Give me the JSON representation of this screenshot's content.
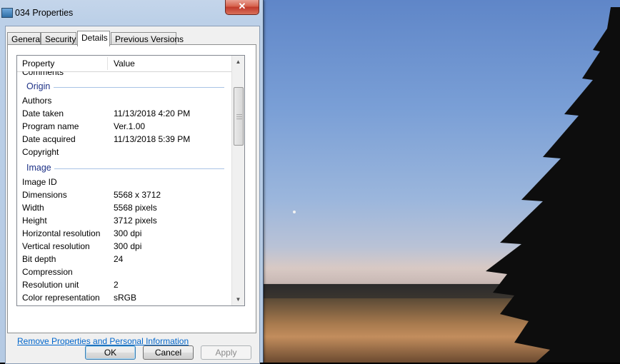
{
  "window": {
    "title": "034 Properties",
    "close_label": "✕"
  },
  "tabs": [
    {
      "label": "General",
      "active": false
    },
    {
      "label": "Security",
      "active": false
    },
    {
      "label": "Details",
      "active": true
    },
    {
      "label": "Previous Versions",
      "active": false
    }
  ],
  "listview": {
    "col_property": "Property",
    "col_value": "Value",
    "rows": {
      "comments": {
        "name": "Comments",
        "value": ""
      },
      "origin_header": "Origin",
      "authors": {
        "name": "Authors",
        "value": ""
      },
      "date_taken": {
        "name": "Date taken",
        "value": "11/13/2018 4:20 PM"
      },
      "program_name": {
        "name": "Program name",
        "value": "Ver.1.00"
      },
      "date_acquired": {
        "name": "Date acquired",
        "value": "11/13/2018 5:39 PM"
      },
      "copyright": {
        "name": "Copyright",
        "value": ""
      },
      "image_header": "Image",
      "image_id": {
        "name": "Image ID",
        "value": ""
      },
      "dimensions": {
        "name": "Dimensions",
        "value": "5568 x 3712"
      },
      "width": {
        "name": "Width",
        "value": "5568 pixels"
      },
      "height": {
        "name": "Height",
        "value": "3712 pixels"
      },
      "h_res": {
        "name": "Horizontal resolution",
        "value": "300 dpi"
      },
      "v_res": {
        "name": "Vertical resolution",
        "value": "300 dpi"
      },
      "bit_depth": {
        "name": "Bit depth",
        "value": "24"
      },
      "compression": {
        "name": "Compression",
        "value": ""
      },
      "res_unit": {
        "name": "Resolution unit",
        "value": "2"
      },
      "color_rep": {
        "name": "Color representation",
        "value": "sRGB"
      }
    }
  },
  "links": {
    "remove_properties": "Remove Properties and Personal Information"
  },
  "buttons": {
    "ok": "OK",
    "cancel": "Cancel",
    "apply": "Apply"
  },
  "colors": {
    "link": "#0066cc",
    "group_header": "#1e3287",
    "close_button": "#c0392b"
  }
}
